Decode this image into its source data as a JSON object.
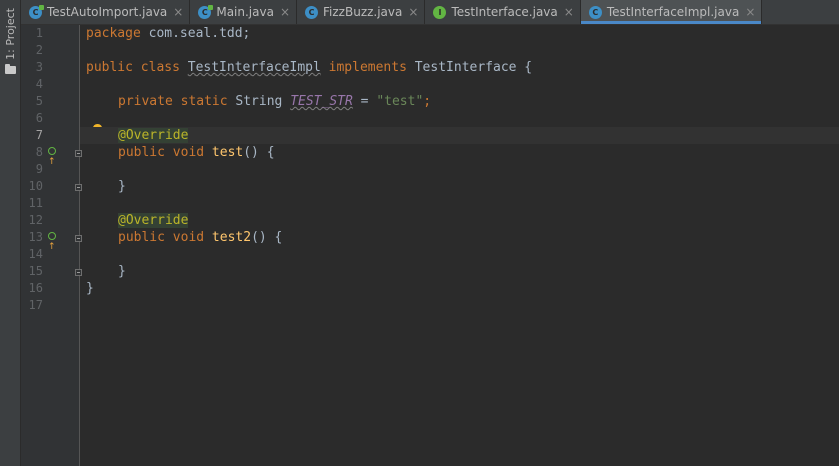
{
  "toolwindow": {
    "project_label": "1: Project"
  },
  "tabs": [
    {
      "label": "TestAutoImport.java",
      "icon": "class-icon",
      "icon_letter": "C",
      "icon_color": "#3d8fc6",
      "active": false,
      "main": true
    },
    {
      "label": "Main.java",
      "icon": "class-icon",
      "icon_letter": "C",
      "icon_color": "#3d8fc6",
      "active": false,
      "main": true
    },
    {
      "label": "FizzBuzz.java",
      "icon": "class-icon",
      "icon_letter": "C",
      "icon_color": "#3d8fc6",
      "active": false,
      "main": false
    },
    {
      "label": "TestInterface.java",
      "icon": "interface-icon",
      "icon_letter": "I",
      "icon_color": "#62b543",
      "active": false,
      "main": false
    },
    {
      "label": "TestInterfaceImpl.java",
      "icon": "class-icon",
      "icon_letter": "C",
      "icon_color": "#3d8fc6",
      "active": true,
      "main": false
    }
  ],
  "editor": {
    "current_line": 7,
    "line_numbers": [
      "1",
      "2",
      "3",
      "4",
      "5",
      "6",
      "7",
      "8",
      "9",
      "10",
      "11",
      "12",
      "13",
      "14",
      "15",
      "16",
      "17"
    ],
    "code": {
      "l1_kw": "package",
      "l1_rest": " com.seal.tdd;",
      "l3_kw1": "public class ",
      "l3_cls": "TestInterfaceImpl",
      "l3_kw2": " implements ",
      "l3_rest": "TestInterface {",
      "l5_kw": "private static ",
      "l5_type": "String ",
      "l5_const": "TEST_STR",
      "l5_eq": " = ",
      "l5_str": "\"test\"",
      "l5_semi": ";",
      "l7_ann": "@Override",
      "l8_kw": "public void ",
      "l8_fn": "test",
      "l8_rest": "() {",
      "l10_brace": "}",
      "l12_ann": "@Override",
      "l13_kw": "public void ",
      "l13_fn": "test2",
      "l13_rest": "() {",
      "l15_brace": "}",
      "l16_brace": "}"
    }
  },
  "colors": {
    "keyword": "#cc7832",
    "annotation": "#bbb529",
    "string": "#6a8759",
    "function": "#ffc66d",
    "constant": "#9876aa",
    "text": "#a9b7c6",
    "active_tab_underline": "#4a88c7"
  }
}
